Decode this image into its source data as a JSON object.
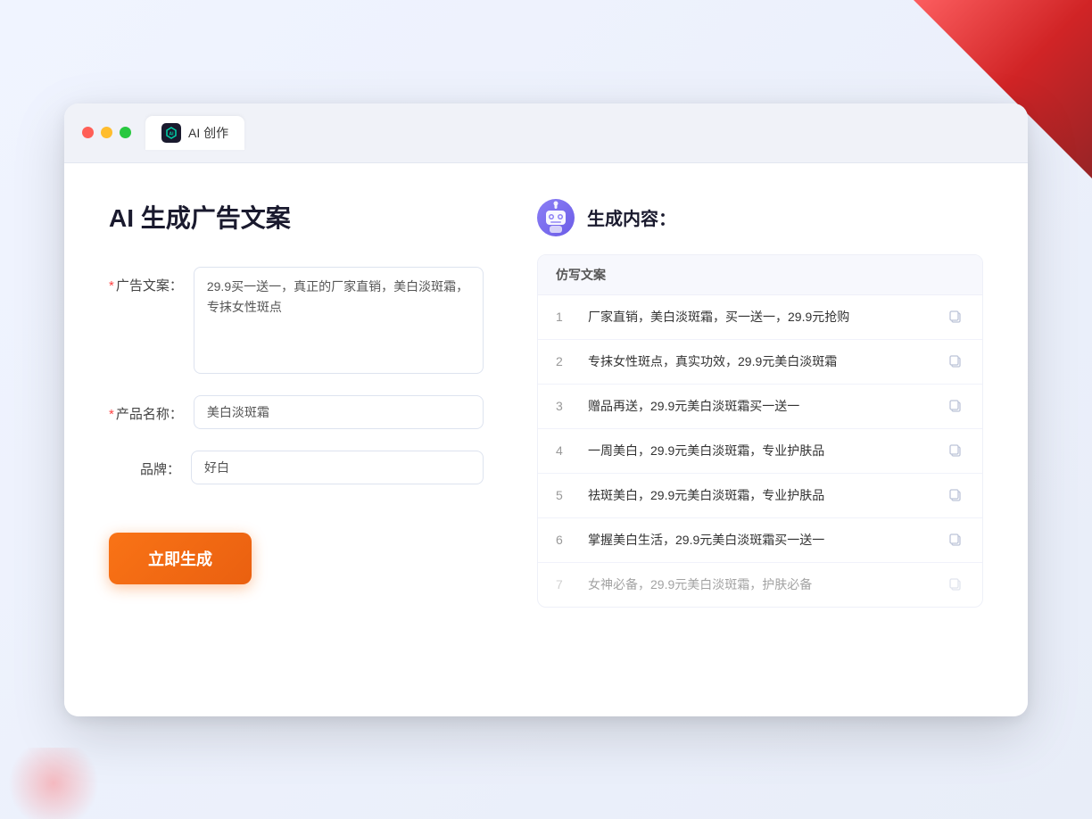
{
  "browser": {
    "tab_icon_text": "AI",
    "tab_title": "AI 创作"
  },
  "page": {
    "title": "AI 生成广告文案",
    "right_title": "生成内容："
  },
  "form": {
    "ad_copy_label": "广告文案：",
    "ad_copy_required": "*",
    "ad_copy_value": "29.9买一送一，真正的厂家直销，美白淡斑霜，专抹女性斑点",
    "product_name_label": "产品名称：",
    "product_name_required": "*",
    "product_name_value": "美白淡斑霜",
    "brand_label": "品牌：",
    "brand_value": "好白",
    "generate_button": "立即生成"
  },
  "results": {
    "column_header": "仿写文案",
    "items": [
      {
        "num": "1",
        "text": "厂家直销，美白淡斑霜，买一送一，29.9元抢购",
        "faded": false
      },
      {
        "num": "2",
        "text": "专抹女性斑点，真实功效，29.9元美白淡斑霜",
        "faded": false
      },
      {
        "num": "3",
        "text": "赠品再送，29.9元美白淡斑霜买一送一",
        "faded": false
      },
      {
        "num": "4",
        "text": "一周美白，29.9元美白淡斑霜，专业护肤品",
        "faded": false
      },
      {
        "num": "5",
        "text": "祛斑美白，29.9元美白淡斑霜，专业护肤品",
        "faded": false
      },
      {
        "num": "6",
        "text": "掌握美白生活，29.9元美白淡斑霜买一送一",
        "faded": false
      },
      {
        "num": "7",
        "text": "女神必备，29.9元美白淡斑霜，护肤必备",
        "faded": true
      }
    ]
  }
}
